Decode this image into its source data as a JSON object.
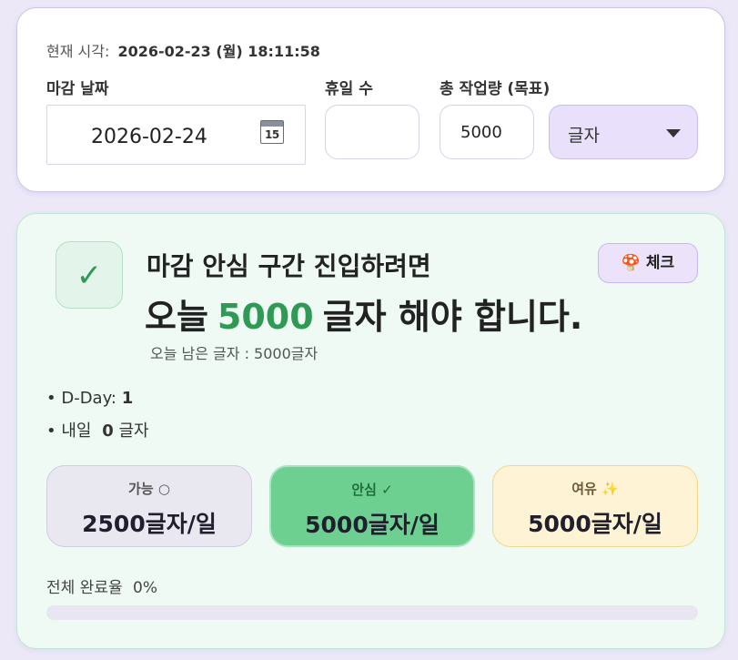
{
  "top": {
    "now_label": "현재 시각:",
    "now_value": "2026-02-23 (월) 18:11:58",
    "deadline_label": "마감 날짜",
    "deadline_value": "2026-02-24",
    "calendar_icon_text": "15",
    "holidays_label": "휴일 수",
    "holidays_value": "",
    "total_label": "총 작업량 (목표)",
    "total_value": "5000",
    "unit_selected": "글자"
  },
  "main": {
    "check_glyph": "✓",
    "headline_line1": "마감 안심 구간 진입하려면",
    "headline_pre": "오늘",
    "headline_number": "5000",
    "headline_post": "글자  해야 합니다.",
    "remaining_text": "오늘 남은 글자 : 5000글자",
    "check_button_label": "체크",
    "dday_label": "• D-Day:",
    "dday_value": "1",
    "tomorrow_label": "• 내일",
    "tomorrow_value": "0",
    "tomorrow_unit": "글자",
    "pills": [
      {
        "title": "가능 ○",
        "value": "2500글자/일"
      },
      {
        "title": "안심 ✓",
        "value": "5000글자/일"
      },
      {
        "title": "여유 ✨",
        "value": "5000글자/일"
      }
    ],
    "progress_label": "전체 완료율",
    "progress_value_text": "0%",
    "progress_fraction": 0
  },
  "colors": {
    "accent_green": "#2e9a55",
    "safe_pill": "#6dd091",
    "spare_pill": "#fff3d6",
    "select_bg": "#e9e1fb"
  },
  "icons": {
    "calendar": "calendar-icon",
    "check": "check-icon",
    "dropdown": "chevron-down-icon",
    "check_button": "mushroom-icon"
  }
}
